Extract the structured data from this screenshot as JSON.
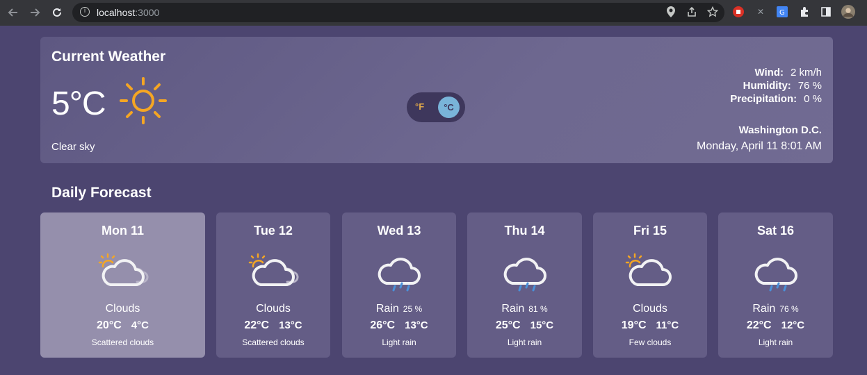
{
  "browser": {
    "url_host": "localhost",
    "url_port": ":3000"
  },
  "current": {
    "title": "Current Weather",
    "temperature": "5°C",
    "description": "Clear sky",
    "icon": "sun-icon",
    "unit_toggle": {
      "f_label": "°F",
      "c_label": "°C",
      "selected": "°C"
    },
    "stats": [
      {
        "label": "Wind:",
        "value": "2 km/h"
      },
      {
        "label": "Humidity:",
        "value": "76 %"
      },
      {
        "label": "Precipitation:",
        "value": "0 %"
      }
    ],
    "location": "Washington D.C.",
    "datetime": "Monday, April 11 8:01 AM"
  },
  "forecast": {
    "title": "Daily Forecast",
    "days": [
      {
        "day": "Mon 11",
        "main": "Clouds",
        "prob": "",
        "high": "20°C",
        "low": "4°C",
        "detail": "Scattered clouds",
        "icon": "partly-cloudy-icon"
      },
      {
        "day": "Tue 12",
        "main": "Clouds",
        "prob": "",
        "high": "22°C",
        "low": "13°C",
        "detail": "Scattered clouds",
        "icon": "partly-cloudy-icon"
      },
      {
        "day": "Wed 13",
        "main": "Rain",
        "prob": "25 %",
        "high": "26°C",
        "low": "13°C",
        "detail": "Light rain",
        "icon": "rain-cloud-icon"
      },
      {
        "day": "Thu 14",
        "main": "Rain",
        "prob": "81 %",
        "high": "25°C",
        "low": "15°C",
        "detail": "Light rain",
        "icon": "rain-cloud-icon"
      },
      {
        "day": "Fri 15",
        "main": "Clouds",
        "prob": "",
        "high": "19°C",
        "low": "11°C",
        "detail": "Few clouds",
        "icon": "few-clouds-icon"
      },
      {
        "day": "Sat 16",
        "main": "Rain",
        "prob": "76 %",
        "high": "22°C",
        "low": "12°C",
        "detail": "Light rain",
        "icon": "rain-cloud-icon"
      }
    ]
  },
  "colors": {
    "background": "#4c4570",
    "card": "#645d86",
    "selected_card": "#958fac",
    "sun": "#f5a623",
    "rain": "#4a90d9",
    "toggle_active": "#79b4d9"
  }
}
